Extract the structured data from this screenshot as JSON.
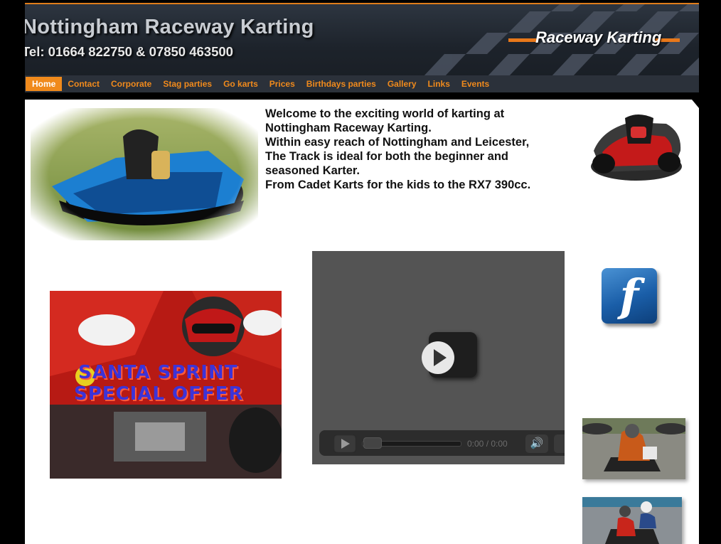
{
  "header": {
    "title": "Nottingham Raceway Karting",
    "tel": "Tel: 01664 822750 & 07850 463500",
    "logo_text": "Raceway Karting",
    "accent": "#f08a1c"
  },
  "nav": {
    "items": [
      {
        "label": "Home",
        "active": true
      },
      {
        "label": "Contact"
      },
      {
        "label": "Corporate"
      },
      {
        "label": "Stag parties"
      },
      {
        "label": "Go karts"
      },
      {
        "label": "Prices"
      },
      {
        "label": "Birthdays parties"
      },
      {
        "label": "Gallery"
      },
      {
        "label": "Links"
      },
      {
        "label": "Events"
      }
    ]
  },
  "welcome": {
    "lines": [
      " Welcome to the exciting world of karting at",
      "Nottingham Raceway Karting.",
      "Within easy reach of Nottingham and Leicester,",
      "The Track is ideal for both the beginner and",
      "seasoned Karter.",
      "From Cadet Karts for the kids to the RX7 390cc."
    ]
  },
  "promo": {
    "line1": "SANTA SPRINT",
    "line2": "SPECIAL OFFER"
  },
  "video": {
    "time": "0:00 / 0:00"
  },
  "icons": {
    "facebook": "f"
  }
}
